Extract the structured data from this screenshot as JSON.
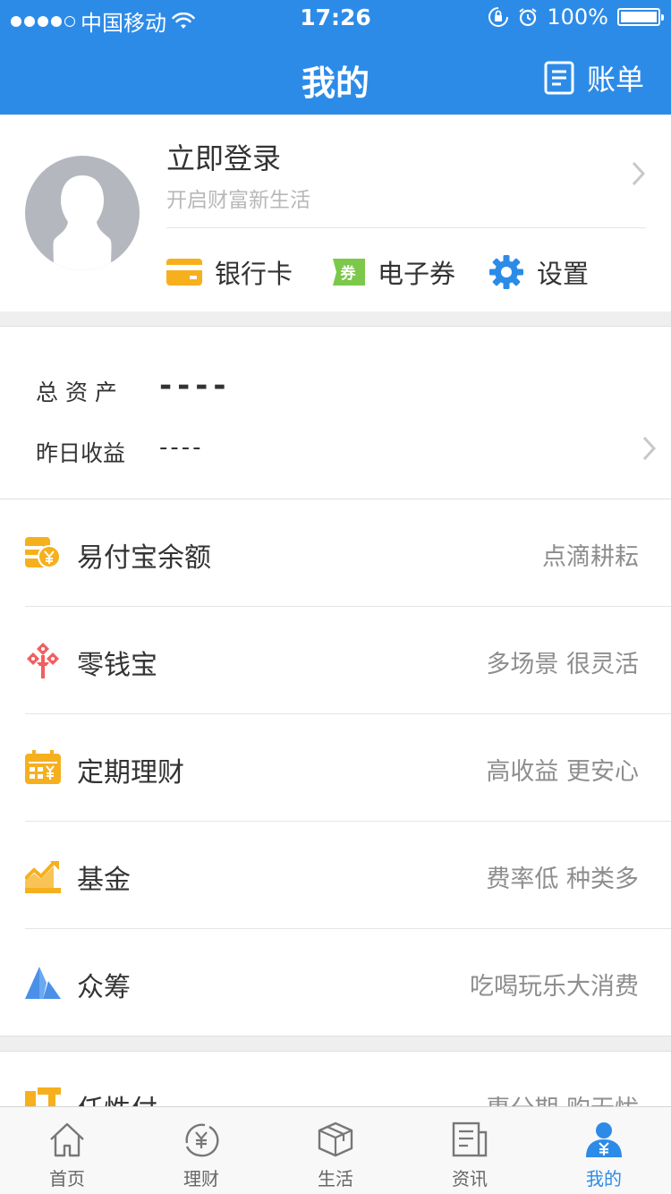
{
  "status_bar": {
    "carrier": "中国移动",
    "time": "17:26",
    "battery": "100%"
  },
  "nav": {
    "title": "我的",
    "bill_label": "账单"
  },
  "profile": {
    "login_title": "立即登录",
    "login_subtitle": "开启财富新生活",
    "quick_links": [
      {
        "label": "银行卡",
        "icon": "bank-card-icon"
      },
      {
        "label": "电子券",
        "icon": "coupon-icon",
        "icon_text": "券"
      },
      {
        "label": "设置",
        "icon": "gear-icon"
      }
    ]
  },
  "assets": {
    "total_label": "总 资 产",
    "total_value": "----",
    "yesterday_label": "昨日收益",
    "yesterday_value": "----"
  },
  "products": [
    {
      "name": "易付宝余额",
      "desc": "点滴耕耘",
      "icon": "wallet-yuan-icon",
      "color": "#f6b01e"
    },
    {
      "name": "零钱宝",
      "desc": "多场景 很灵活",
      "icon": "change-treasure-icon",
      "color": "#f25e5e"
    },
    {
      "name": "定期理财",
      "desc": "高收益 更安心",
      "icon": "calendar-yuan-icon",
      "color": "#f6b01e"
    },
    {
      "name": "基金",
      "desc": "费率低 种类多",
      "icon": "trend-chart-icon",
      "color": "#f6b01e"
    },
    {
      "name": "众筹",
      "desc": "吃喝玩乐大消费",
      "icon": "crowdfund-icon",
      "color": "#4a90e8"
    }
  ],
  "extra_row": {
    "name": "任性付",
    "desc": "惠分期 购无忧"
  },
  "tabbar": {
    "items": [
      {
        "label": "首页",
        "icon": "home-icon"
      },
      {
        "label": "理财",
        "icon": "yuan-circle-icon"
      },
      {
        "label": "生活",
        "icon": "box-icon"
      },
      {
        "label": "资讯",
        "icon": "news-icon"
      },
      {
        "label": "我的",
        "icon": "user-icon"
      }
    ],
    "active_index": 4
  },
  "colors": {
    "primary": "#2d8be8",
    "accent_yellow": "#f6b01e",
    "accent_red": "#f25e5e",
    "coupon_green": "#7cc84a"
  }
}
